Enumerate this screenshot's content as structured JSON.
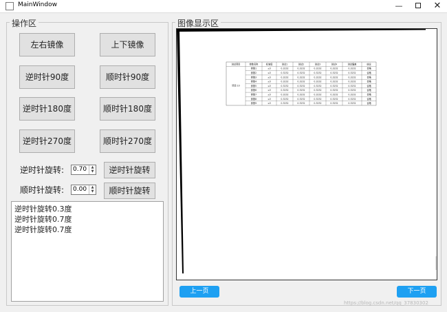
{
  "window": {
    "title": "MainWindow",
    "controls": {
      "minimize": "—",
      "close": "✕"
    }
  },
  "operations": {
    "group_title": "操作区",
    "buttons": {
      "mirror_lr": "左右镜像",
      "mirror_ud": "上下镜像",
      "ccw90": "逆时针90度",
      "cw90": "顺时针90度",
      "ccw180": "逆时针180度",
      "cw180": "顺时针180度",
      "ccw270": "逆时针270度",
      "cw270": "顺时针270度"
    },
    "ccw_rotate": {
      "label": "逆时针旋转:",
      "value": "0.70",
      "button": "逆时针旋转"
    },
    "cw_rotate": {
      "label": "顺时针旋转:",
      "value": "0.00",
      "button": "顺时针旋转"
    },
    "log": [
      "逆时针旋转0.3度",
      "逆时针旋转0.7度",
      "逆时针旋转0.7度"
    ]
  },
  "display": {
    "group_title": "图像显示区",
    "prev_page": "上一页",
    "next_page": "下一页",
    "table": {
      "headers": [
        "测试项目",
        "参数名称",
        "标准值",
        "测试1",
        "测试2",
        "测试3",
        "测试4",
        "测试偏差",
        "结论"
      ],
      "group_label": "项目 10",
      "rows": [
        [
          "参数1",
          "≤3",
          "0.3232",
          "0.3232",
          "0.3232",
          "0.3232",
          "0.3232",
          "合格"
        ],
        [
          "参数2",
          "≤3",
          "0.3232",
          "0.3232",
          "0.3232",
          "0.3232",
          "0.3232",
          "合格"
        ],
        [
          "参数3",
          "≤3",
          "0.3232",
          "0.3232",
          "0.3232",
          "0.3232",
          "0.3232",
          "合格"
        ],
        [
          "参数4",
          "≤3",
          "0.3232",
          "0.3232",
          "0.3232",
          "0.3232",
          "0.3232",
          "合格"
        ],
        [
          "参数5",
          "≤3",
          "0.3232",
          "0.3232",
          "0.3232",
          "0.3232",
          "0.3232",
          "合格"
        ],
        [
          "参数6",
          "≤3",
          "0.3232",
          "0.3232",
          "0.3232",
          "0.3232",
          "0.3232",
          "合格"
        ],
        [
          "参数7",
          "≤3",
          "0.3232",
          "0.3232",
          "0.3232",
          "0.3232",
          "0.3232",
          "合格"
        ],
        [
          "参数8",
          "≤3",
          "0.3232",
          "0.3232",
          "0.3232",
          "0.3232",
          "0.3232",
          "合格"
        ],
        [
          "参数9",
          "≤3",
          "0.3232",
          "0.3232",
          "0.3232",
          "0.3232",
          "0.3232",
          "合格"
        ]
      ]
    }
  },
  "watermark": "https://blog.csdn.net/qq_37830302",
  "colors": {
    "nav_button": "#1ea0f2",
    "window_bg": "#f0f0f0"
  }
}
